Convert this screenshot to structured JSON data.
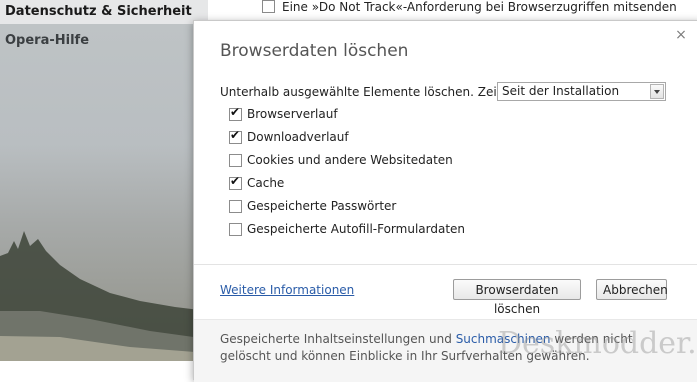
{
  "sidebar": {
    "active_item": "Datenschutz & Sicherheit",
    "items": [
      "Opera-Hilfe"
    ]
  },
  "background_page": {
    "dnt_label": "Eine »Do Not Track«-Anforderung bei Browserzugriffen mitsenden",
    "dnt_checked": false
  },
  "dialog": {
    "title": "Browserdaten löschen",
    "close_glyph": "×",
    "period_label": "Unterhalb ausgewählte Elemente löschen. Zeitraum:",
    "period_value": "Seit der Installation",
    "options": [
      {
        "label": "Browserverlauf",
        "checked": true
      },
      {
        "label": "Downloadverlauf",
        "checked": true
      },
      {
        "label": "Cookies und andere Websitedaten",
        "checked": false
      },
      {
        "label": "Cache",
        "checked": true
      },
      {
        "label": "Gespeicherte Passwörter",
        "checked": false
      },
      {
        "label": "Gespeicherte Autofill-Formulardaten",
        "checked": false
      }
    ],
    "more_info_link": "Weitere Informationen",
    "clear_button": "Browserdaten löschen",
    "cancel_button": "Abbrechen",
    "footer_text_before": "Gespeicherte Inhaltseinstellungen und ",
    "footer_link": "Suchmaschinen",
    "footer_text_after": " werden nicht gelöscht und können Einblicke in Ihr Surfverhalten gewähren."
  },
  "watermark": "Deskmodder.de",
  "colors": {
    "link": "#2a5ca8",
    "sidebar_active_bg": "#e6e7e8"
  }
}
